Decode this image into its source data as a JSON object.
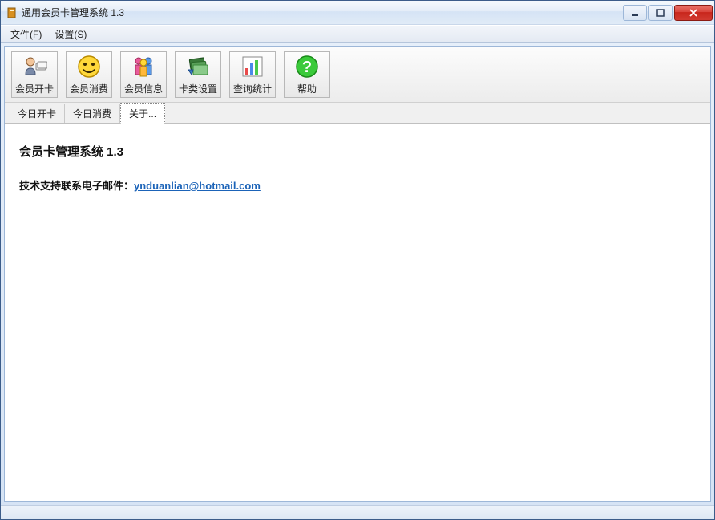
{
  "window": {
    "title": "通用会员卡管理系统 1.3"
  },
  "menubar": {
    "file": "文件(F)",
    "settings": "设置(S)"
  },
  "toolbar": {
    "open_card": "会员开卡",
    "consume": "会员消费",
    "info": "会员信息",
    "card_type": "卡类设置",
    "query": "查询统计",
    "help": "帮助"
  },
  "tabs": {
    "today_open": "今日开卡",
    "today_consume": "今日消费",
    "about": "关于..."
  },
  "about": {
    "title": "会员卡管理系统 1.3",
    "support_label": "技术支持联系电子邮件：",
    "email": "ynduanlian@hotmail.com"
  }
}
